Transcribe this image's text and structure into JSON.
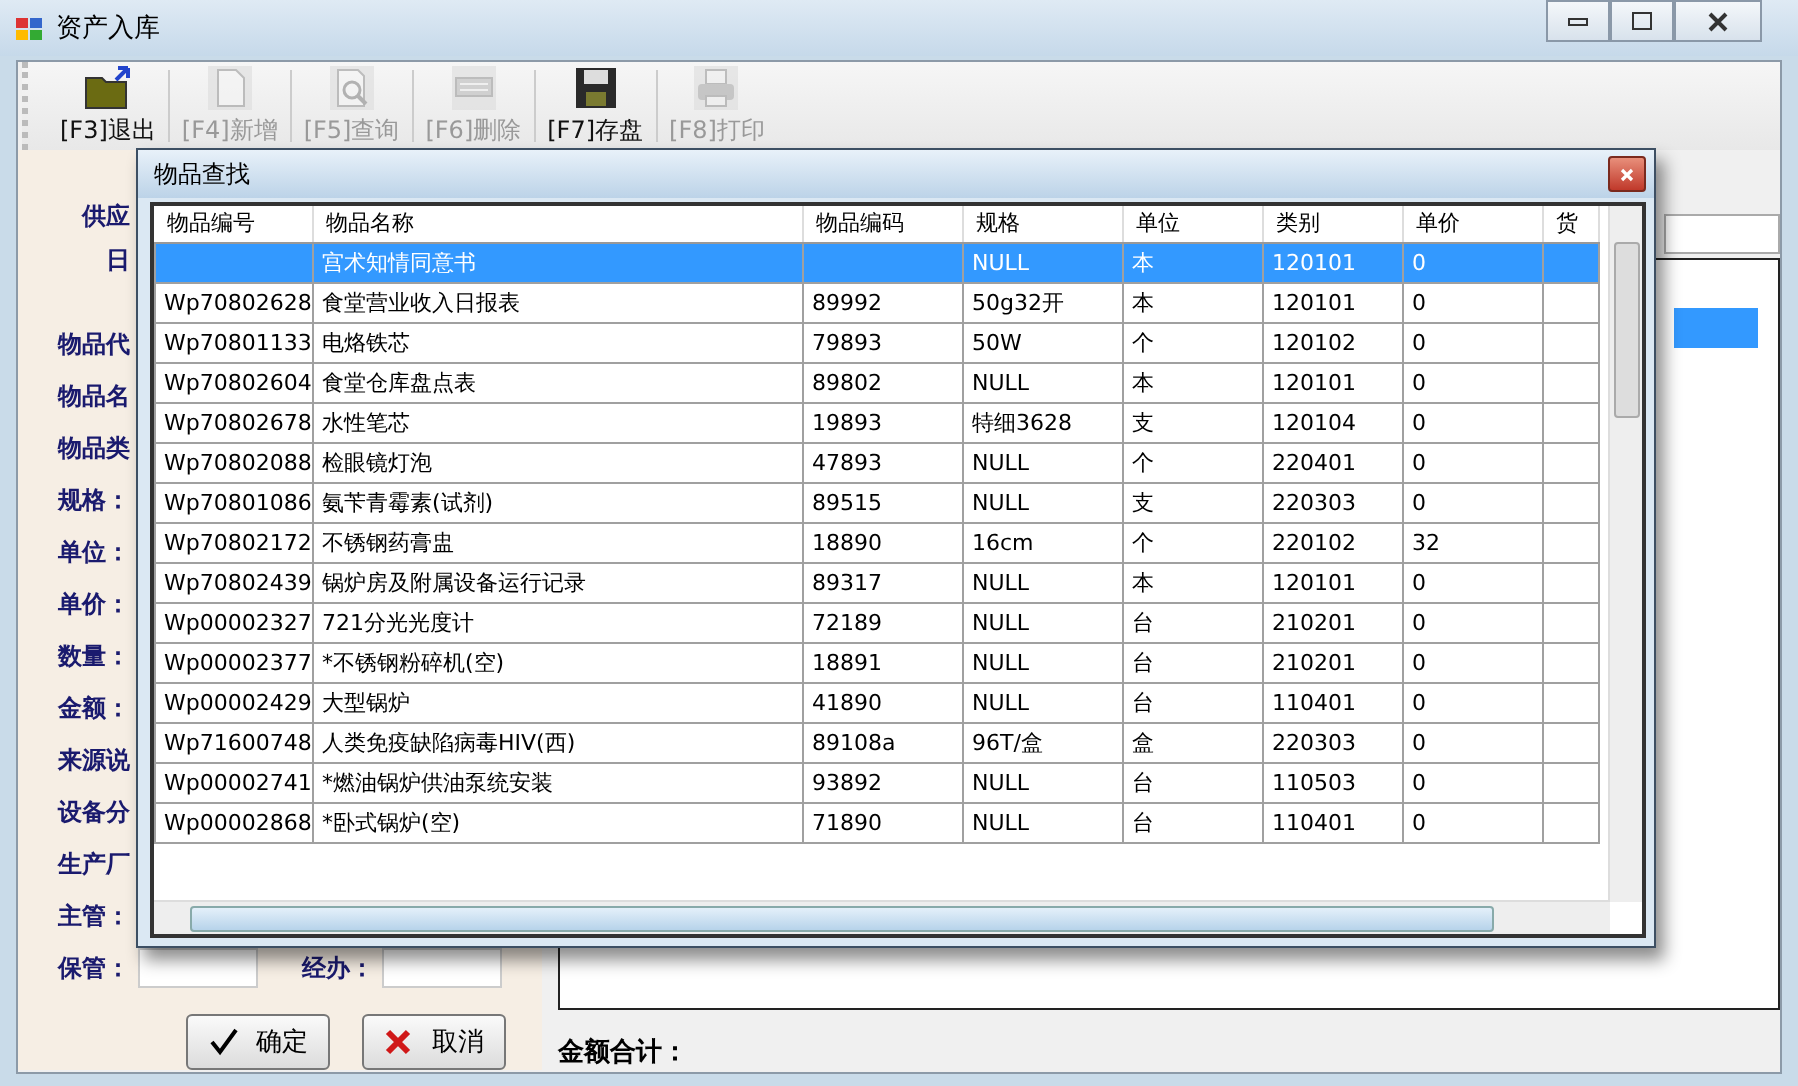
{
  "window": {
    "title": "资产入库"
  },
  "toolbar": [
    {
      "label": "[F3]退出",
      "kind": "exit",
      "disabled": false
    },
    {
      "label": "[F4]新增",
      "kind": "new",
      "disabled": true
    },
    {
      "label": "[F5]查询",
      "kind": "query",
      "disabled": true
    },
    {
      "label": "[F6]删除",
      "kind": "delete",
      "disabled": true
    },
    {
      "label": "[F7]存盘",
      "kind": "save",
      "disabled": false
    },
    {
      "label": "[F8]打印",
      "kind": "print",
      "disabled": true
    }
  ],
  "form": {
    "fields": [
      {
        "label": "供应"
      },
      {
        "label": "日"
      },
      {
        "label": "物品代"
      },
      {
        "label": "物品名"
      },
      {
        "label": "物品类"
      },
      {
        "label": "规格："
      },
      {
        "label": "单位："
      },
      {
        "label": "单价："
      },
      {
        "label": "数量："
      },
      {
        "label": "金额："
      },
      {
        "label": "来源说"
      },
      {
        "label": "设备分"
      },
      {
        "label": "生产厂"
      },
      {
        "label": "主管："
      },
      {
        "label": "保管：",
        "second_label": "经办："
      }
    ],
    "buttons": [
      {
        "label": "确定",
        "kind": "ok"
      },
      {
        "label": "取消",
        "kind": "cancel"
      }
    ],
    "total_label": "金额合计："
  },
  "dialog": {
    "title": "物品查找",
    "columns": [
      "物品编号",
      "物品名称",
      "物品编码",
      "规格",
      "单位",
      "类别",
      "单价",
      "货"
    ],
    "rows": [
      {
        "name": "宫术知情同意书",
        "spec": "NULL",
        "unit": "本",
        "category": "120101",
        "price": "0",
        "selected": true
      },
      {
        "id": "Wp70802628",
        "name": "食堂营业收入日报表",
        "code": "89992",
        "spec": "50g32开",
        "unit": "本",
        "category": "120101",
        "price": "0",
        "selected": false
      },
      {
        "id": "Wp70801133",
        "name": "电烙铁芯",
        "code": "79893",
        "spec": "50W",
        "unit": "个",
        "category": "120102",
        "price": "0",
        "selected": false
      },
      {
        "id": "Wp70802604",
        "name": "食堂仓库盘点表",
        "code": "89802",
        "spec": "NULL",
        "unit": "本",
        "category": "120101",
        "price": "0",
        "selected": false
      },
      {
        "id": "Wp70802678",
        "name": "水性笔芯",
        "code": "19893",
        "spec": "特细3628",
        "unit": "支",
        "category": "120104",
        "price": "0",
        "selected": false
      },
      {
        "id": "Wp70802088",
        "name": "检眼镜灯泡",
        "code": "47893",
        "spec": "NULL",
        "unit": "个",
        "category": "220401",
        "price": "0",
        "selected": false
      },
      {
        "id": "Wp70801086",
        "name": "氨苄青霉素(试剂)",
        "code": "89515",
        "spec": "NULL",
        "unit": "支",
        "category": "220303",
        "price": "0",
        "selected": false
      },
      {
        "id": "Wp70802172",
        "name": "不锈钢药膏盅",
        "code": "18890",
        "spec": "16cm",
        "unit": "个",
        "category": "220102",
        "price": "32",
        "selected": false
      },
      {
        "id": "Wp70802439",
        "name": "锅炉房及附属设备运行记录",
        "code": "89317",
        "spec": "NULL",
        "unit": "本",
        "category": "120101",
        "price": "0",
        "selected": false
      },
      {
        "id": "Wp00002327",
        "name": "721分光光度计",
        "code": "72189",
        "spec": "NULL",
        "unit": "台",
        "category": "210201",
        "price": "0",
        "selected": false
      },
      {
        "id": "Wp00002377",
        "name": "*不锈钢粉碎机(空)",
        "code": "18891",
        "spec": "NULL",
        "unit": "台",
        "category": "210201",
        "price": "0",
        "selected": false
      },
      {
        "id": "Wp00002429",
        "name": "大型锅炉",
        "code": "41890",
        "spec": "NULL",
        "unit": "台",
        "category": "110401",
        "price": "0",
        "selected": false
      },
      {
        "id": "Wp71600748",
        "name": "人类免疫缺陷病毒HIV(西)",
        "code": "89108a",
        "spec": "96T/盒",
        "unit": "盒",
        "category": "220303",
        "price": "0",
        "selected": false
      },
      {
        "id": "Wp00002741",
        "name": "*燃油锅炉供油泵统安装",
        "code": "93892",
        "spec": "NULL",
        "unit": "台",
        "category": "110503",
        "price": "0",
        "selected": false
      },
      {
        "id": "Wp00002868",
        "name": "*卧式锅炉(空)",
        "code": "71890",
        "spec": "NULL",
        "unit": "台",
        "category": "110401",
        "price": "0",
        "selected": false
      }
    ]
  }
}
